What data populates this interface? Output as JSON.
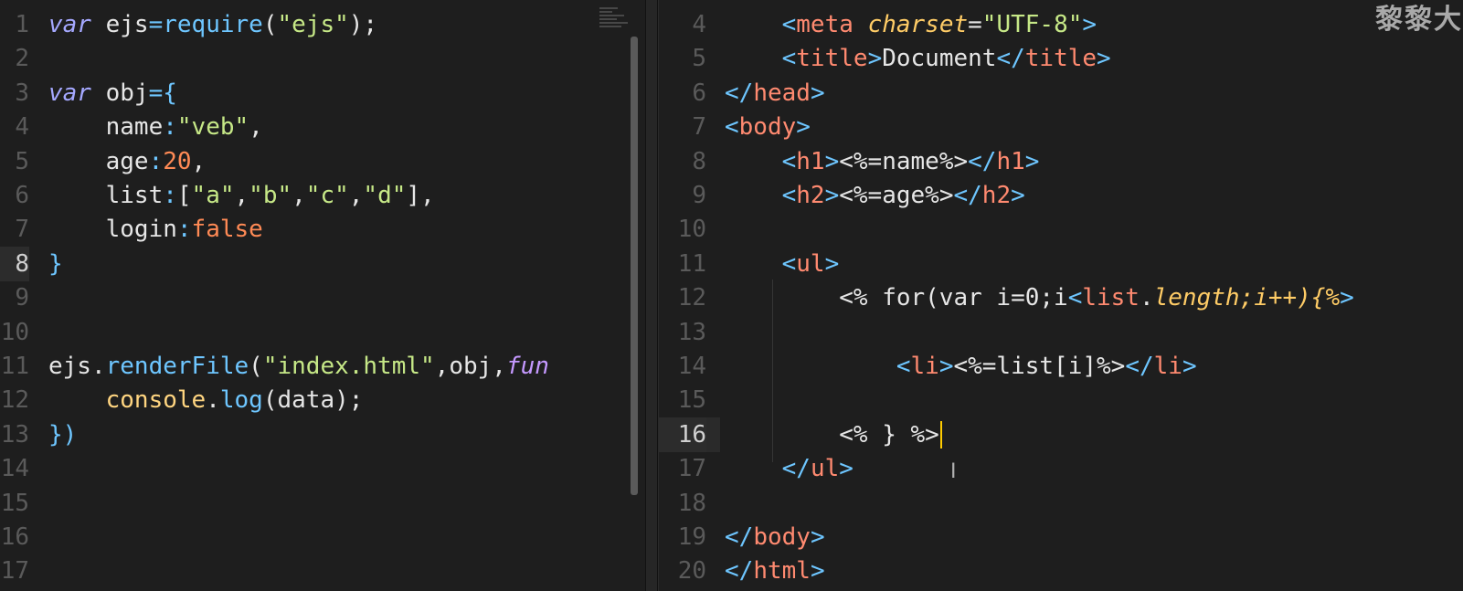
{
  "watermark": "黎黎大",
  "left_editor": {
    "lines": [
      {
        "n": "1",
        "tokens": [
          [
            "var",
            "kw-i"
          ],
          [
            " ejs",
            "ident"
          ],
          [
            "=",
            "op"
          ],
          [
            "require",
            "method"
          ],
          [
            "(",
            "punc"
          ],
          [
            "\"ejs\"",
            "str"
          ],
          [
            ");",
            "punc"
          ]
        ]
      },
      {
        "n": "2",
        "tokens": []
      },
      {
        "n": "3",
        "tokens": [
          [
            "var",
            "kw-i"
          ],
          [
            " obj",
            "ident"
          ],
          [
            "=",
            "op"
          ],
          [
            "{",
            "brace"
          ]
        ]
      },
      {
        "n": "4",
        "tokens": [
          [
            "    name",
            "ident"
          ],
          [
            ":",
            "op"
          ],
          [
            "\"veb\"",
            "str"
          ],
          [
            ",",
            "punc"
          ]
        ]
      },
      {
        "n": "5",
        "tokens": [
          [
            "    age",
            "ident"
          ],
          [
            ":",
            "op"
          ],
          [
            "20",
            "num"
          ],
          [
            ",",
            "punc"
          ]
        ]
      },
      {
        "n": "6",
        "tokens": [
          [
            "    list",
            "ident"
          ],
          [
            ":",
            "op"
          ],
          [
            "[",
            "punc"
          ],
          [
            "\"a\"",
            "str"
          ],
          [
            ",",
            "punc"
          ],
          [
            "\"b\"",
            "str"
          ],
          [
            ",",
            "punc"
          ],
          [
            "\"c\"",
            "str"
          ],
          [
            ",",
            "punc"
          ],
          [
            "\"d\"",
            "str"
          ],
          [
            "],",
            "punc"
          ]
        ]
      },
      {
        "n": "7",
        "tokens": [
          [
            "    login",
            "ident"
          ],
          [
            ":",
            "op"
          ],
          [
            "false",
            "bool"
          ]
        ]
      },
      {
        "n": "8",
        "active": true,
        "tokens": [
          [
            "}",
            "brace"
          ]
        ]
      },
      {
        "n": "9",
        "tokens": []
      },
      {
        "n": "10",
        "tokens": []
      },
      {
        "n": "11",
        "tokens": [
          [
            "ejs",
            "ident"
          ],
          [
            ".",
            "punc"
          ],
          [
            "renderFile",
            "method"
          ],
          [
            "(",
            "punc"
          ],
          [
            "\"index.html\"",
            "str"
          ],
          [
            ",obj,",
            "punc"
          ],
          [
            "fun",
            "fn-i"
          ]
        ]
      },
      {
        "n": "12",
        "tokens": [
          [
            "    ",
            "ident"
          ],
          [
            "console",
            "obj2"
          ],
          [
            ".",
            "punc"
          ],
          [
            "log",
            "method"
          ],
          [
            "(data);",
            "punc"
          ]
        ]
      },
      {
        "n": "13",
        "tokens": [
          [
            "})",
            "brace"
          ]
        ]
      },
      {
        "n": "14",
        "tokens": []
      },
      {
        "n": "15",
        "tokens": []
      },
      {
        "n": "16",
        "tokens": []
      },
      {
        "n": "17",
        "tokens": []
      }
    ]
  },
  "right_editor": {
    "lines": [
      {
        "n": "4",
        "tokens": [
          [
            "    ",
            "tag"
          ],
          [
            "<",
            "br"
          ],
          [
            "meta",
            "tagname"
          ],
          [
            " ",
            "tag"
          ],
          [
            "charset",
            "attr"
          ],
          [
            "=",
            "tag"
          ],
          [
            "\"UTF-8\"",
            "str"
          ],
          [
            ">",
            "br"
          ]
        ]
      },
      {
        "n": "5",
        "tokens": [
          [
            "    ",
            "tag"
          ],
          [
            "<",
            "br"
          ],
          [
            "title",
            "tagname"
          ],
          [
            ">",
            "br"
          ],
          [
            "Document",
            "tag"
          ],
          [
            "</",
            "br"
          ],
          [
            "title",
            "tagname"
          ],
          [
            ">",
            "br"
          ]
        ]
      },
      {
        "n": "6",
        "tokens": [
          [
            "</",
            "br"
          ],
          [
            "head",
            "tagname"
          ],
          [
            ">",
            "br"
          ]
        ]
      },
      {
        "n": "7",
        "tokens": [
          [
            "<",
            "br"
          ],
          [
            "body",
            "tagname"
          ],
          [
            ">",
            "br"
          ]
        ]
      },
      {
        "n": "8",
        "tokens": [
          [
            "    ",
            "tag"
          ],
          [
            "<",
            "br"
          ],
          [
            "h1",
            "tagname"
          ],
          [
            ">",
            "br"
          ],
          [
            "<%=name%>",
            "tag"
          ],
          [
            "</",
            "br"
          ],
          [
            "h1",
            "tagname"
          ],
          [
            ">",
            "br"
          ]
        ]
      },
      {
        "n": "9",
        "tokens": [
          [
            "    ",
            "tag"
          ],
          [
            "<",
            "br"
          ],
          [
            "h2",
            "tagname"
          ],
          [
            ">",
            "br"
          ],
          [
            "<%=age%>",
            "tag"
          ],
          [
            "</",
            "br"
          ],
          [
            "h2",
            "tagname"
          ],
          [
            ">",
            "br"
          ]
        ]
      },
      {
        "n": "10",
        "tokens": []
      },
      {
        "n": "11",
        "tokens": [
          [
            "    ",
            "tag"
          ],
          [
            "<",
            "br"
          ],
          [
            "ul",
            "tagname"
          ],
          [
            ">",
            "br"
          ]
        ]
      },
      {
        "n": "12",
        "tokens": [
          [
            "        ",
            "tag"
          ],
          [
            "<% for(var i=0;i",
            "tag"
          ],
          [
            "<",
            "br"
          ],
          [
            "list",
            "err"
          ],
          [
            ".",
            "tag"
          ],
          [
            "length;i++){%",
            "err-i"
          ],
          [
            ">",
            "br"
          ]
        ]
      },
      {
        "n": "13",
        "tokens": []
      },
      {
        "n": "14",
        "tokens": [
          [
            "            ",
            "tag"
          ],
          [
            "<",
            "br"
          ],
          [
            "li",
            "tagname"
          ],
          [
            ">",
            "br"
          ],
          [
            "<%=list[i]%>",
            "tag"
          ],
          [
            "</",
            "br"
          ],
          [
            "li",
            "tagname"
          ],
          [
            ">",
            "br"
          ]
        ]
      },
      {
        "n": "15",
        "tokens": []
      },
      {
        "n": "16",
        "active": true,
        "cursor": true,
        "tokens": [
          [
            "        ",
            "tag"
          ],
          [
            "<% } %>",
            "tag"
          ]
        ]
      },
      {
        "n": "17",
        "tokens": [
          [
            "    ",
            "tag"
          ],
          [
            "</",
            "br"
          ],
          [
            "ul",
            "tagname"
          ],
          [
            ">",
            "br"
          ]
        ]
      },
      {
        "n": "18",
        "tokens": []
      },
      {
        "n": "19",
        "tokens": [
          [
            "</",
            "br"
          ],
          [
            "body",
            "tagname"
          ],
          [
            ">",
            "br"
          ]
        ]
      },
      {
        "n": "20",
        "tokens": [
          [
            "</",
            "br"
          ],
          [
            "html",
            "tagname"
          ],
          [
            ">",
            "br"
          ]
        ]
      }
    ]
  },
  "colors": {
    "background": "#1e1e1e",
    "cursor": "#ffcc00",
    "string": "#c6e887",
    "keyword": "#a5a8ff"
  }
}
